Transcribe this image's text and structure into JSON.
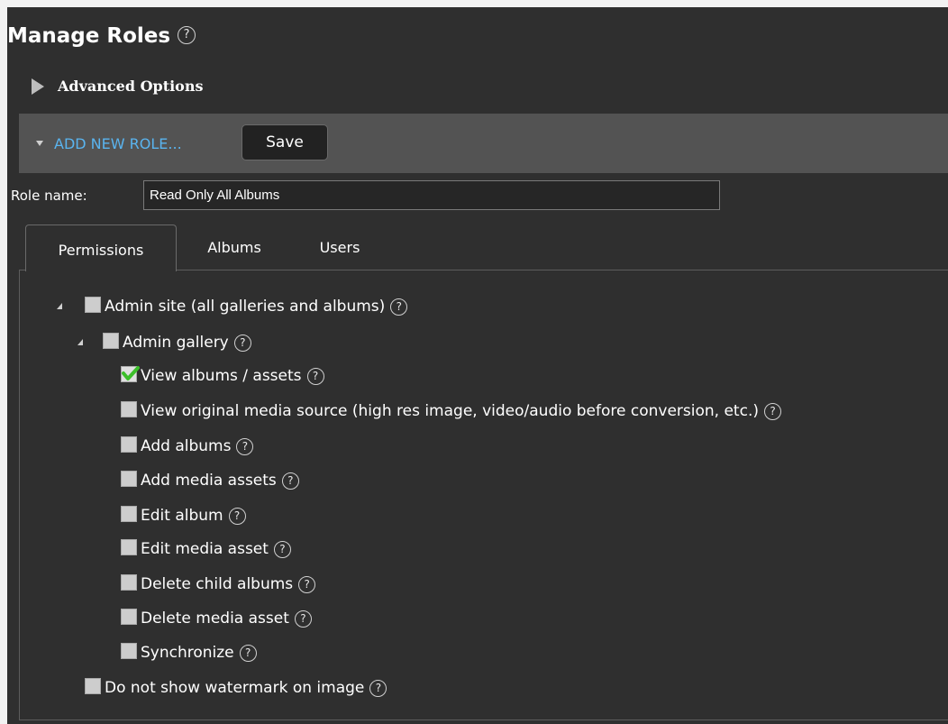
{
  "header": {
    "title": "Manage Roles",
    "help": "?"
  },
  "advanced": {
    "label": "Advanced Options"
  },
  "toolbar": {
    "add_new_role": "ADD NEW ROLE...",
    "save_label": "Save"
  },
  "role": {
    "name_label": "Role name:",
    "name_value": "Read Only All Albums"
  },
  "tabs": [
    {
      "label": "Permissions",
      "active": true
    },
    {
      "label": "Albums",
      "active": false
    },
    {
      "label": "Users",
      "active": false
    }
  ],
  "permissions": [
    {
      "label": "Admin site (all galleries and albums)",
      "checked": false,
      "expandable": true,
      "help": "?"
    },
    {
      "label": "Admin gallery",
      "checked": false,
      "expandable": true,
      "help": "?"
    },
    {
      "label": "View albums / assets",
      "checked": true,
      "help": "?"
    },
    {
      "label": "View original media source (high res image, video/audio before conversion, etc.)",
      "checked": false,
      "help": "?"
    },
    {
      "label": "Add albums",
      "checked": false,
      "help": "?"
    },
    {
      "label": "Add media assets",
      "checked": false,
      "help": "?"
    },
    {
      "label": "Edit album",
      "checked": false,
      "help": "?"
    },
    {
      "label": "Edit media asset",
      "checked": false,
      "help": "?"
    },
    {
      "label": "Delete child albums",
      "checked": false,
      "help": "?"
    },
    {
      "label": "Delete media asset",
      "checked": false,
      "help": "?"
    },
    {
      "label": "Synchronize",
      "checked": false,
      "help": "?"
    },
    {
      "label": "Do not show watermark on image",
      "checked": false,
      "help": "?"
    }
  ],
  "colors": {
    "background": "#2f2f2f",
    "toolbar": "#535353",
    "link": "#5ab4ef",
    "check": "#3cbf2a"
  },
  "icons": {
    "help": "question-circle-icon",
    "expand": "triangle-right-icon",
    "collapse": "triangle-down-icon",
    "check": "check-icon"
  }
}
